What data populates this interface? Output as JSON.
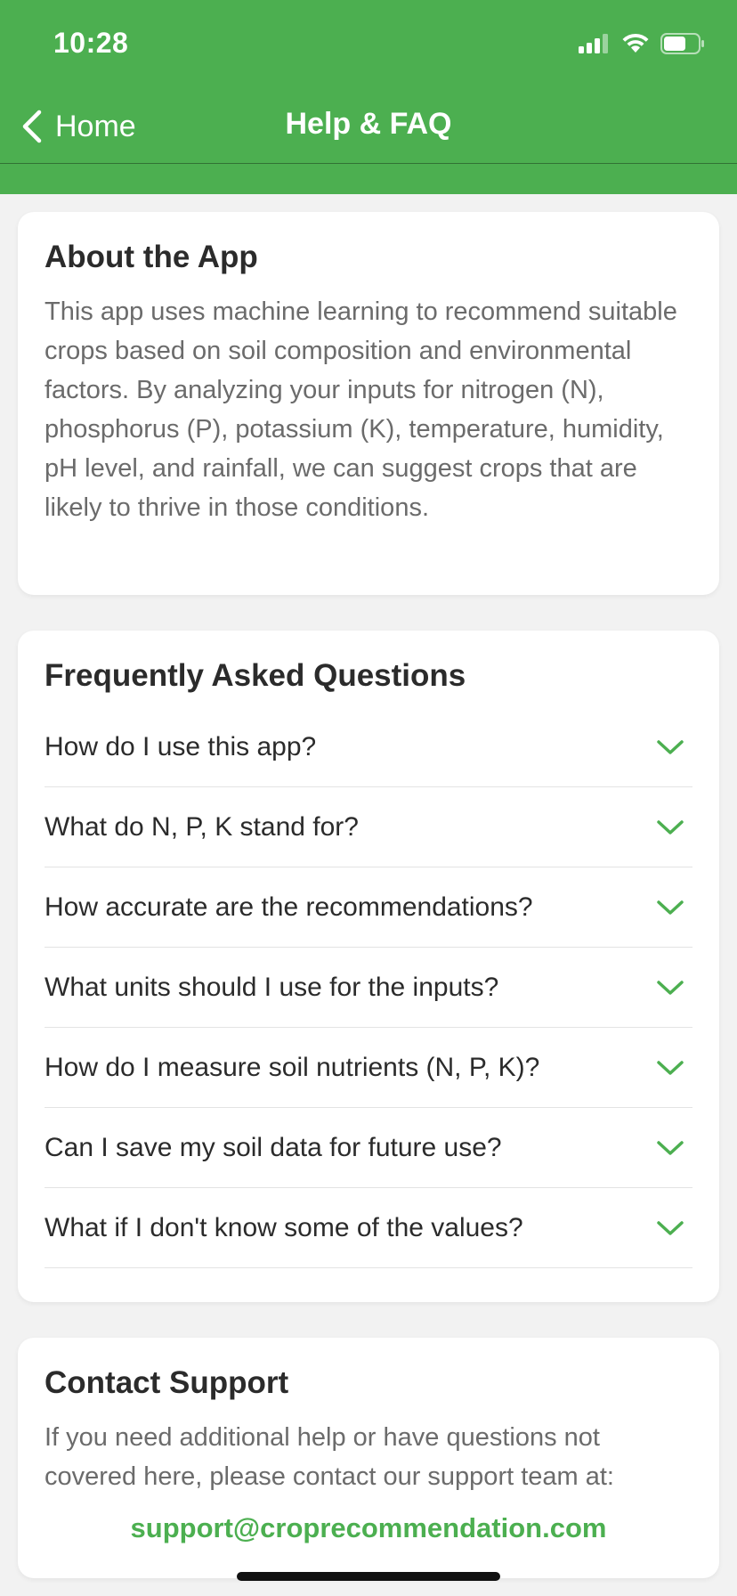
{
  "status_bar": {
    "time": "10:28"
  },
  "nav": {
    "back_label": "Home",
    "title": "Help & FAQ"
  },
  "about": {
    "title": "About the App",
    "text": "This app uses machine learning to recommend suitable crops based on soil composition and environmental factors. By analyzing your inputs for nitrogen (N), phosphorus (P), potassium (K), temperature, humidity, pH level, and rainfall, we can suggest crops that are likely to thrive in those conditions."
  },
  "faq": {
    "title": "Frequently Asked Questions",
    "items": [
      {
        "question": "How do I use this app?"
      },
      {
        "question": "What do N, P, K stand for?"
      },
      {
        "question": "How accurate are the recommendations?"
      },
      {
        "question": "What units should I use for the inputs?"
      },
      {
        "question": "How do I measure soil nutrients (N, P, K)?"
      },
      {
        "question": "Can I save my soil data for future use?"
      },
      {
        "question": "What if I don't know some of the values?"
      }
    ]
  },
  "contact": {
    "title": "Contact Support",
    "text": "If you need additional help or have questions not covered here, please contact our support team at:",
    "email": "support@croprecommendation.com"
  },
  "colors": {
    "accent": "#4caf50",
    "background": "#f2f2f2"
  },
  "icons": {
    "back": "chevron-left-icon",
    "expand": "chevron-down-icon"
  }
}
